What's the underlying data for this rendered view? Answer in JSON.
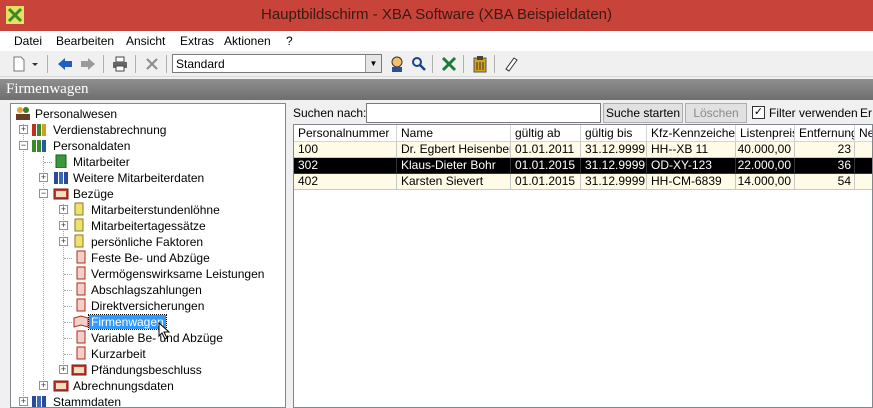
{
  "window": {
    "title": "Hauptbildschirm - XBA Software (XBA Beispieldaten)"
  },
  "menu": [
    "Datei",
    "Bearbeiten",
    "Ansicht",
    "Extras",
    "Aktionen",
    "?"
  ],
  "toolbar": {
    "view_combo_value": "Standard"
  },
  "panel": {
    "title": "Firmenwagen"
  },
  "tree": {
    "items": [
      {
        "label": "Personalwesen"
      },
      {
        "label": "Verdienstabrechnung"
      },
      {
        "label": "Personaldaten"
      },
      {
        "label": "Mitarbeiter"
      },
      {
        "label": "Weitere Mitarbeiterdaten"
      },
      {
        "label": "Bezüge"
      },
      {
        "label": "Mitarbeiterstundenlöhne"
      },
      {
        "label": "Mitarbeitertagessätze"
      },
      {
        "label": "persönliche Faktoren"
      },
      {
        "label": "Feste Be- und Abzüge"
      },
      {
        "label": "Vermögenswirksame Leistungen"
      },
      {
        "label": "Abschlagszahlungen"
      },
      {
        "label": "Direktversicherungen"
      },
      {
        "label": "Firmenwagen"
      },
      {
        "label": "Variable Be- und Abzüge"
      },
      {
        "label": "Kurzarbeit"
      },
      {
        "label": "Pfändungsbeschluss"
      },
      {
        "label": "Abrechnungsdaten"
      },
      {
        "label": "Stammdaten"
      }
    ]
  },
  "search": {
    "label": "Suchen nach:",
    "value": "",
    "start_button": "Suche starten",
    "clear_button": "Löschen",
    "filter_label": "Filter verwenden",
    "filter_checked": "✓",
    "extra_button": "Er"
  },
  "table": {
    "columns": [
      "Personalnummer",
      "Name",
      "gültig ab",
      "gültig bis",
      "Kfz-Kennzeichen",
      "Listenpreis",
      "Entfernung",
      "Ne"
    ],
    "rows": [
      {
        "cells": [
          "100",
          "Dr. Egbert Heisenberg",
          "01.01.2011",
          "31.12.9999",
          "HH--XB 11",
          "40.000,00",
          "23",
          ""
        ]
      },
      {
        "cells": [
          "302",
          "Klaus-Dieter Bohr",
          "01.01.2015",
          "31.12.9999",
          "OD-XY-123",
          "22.000,00",
          "36",
          ""
        ]
      },
      {
        "cells": [
          "402",
          "Karsten Sievert",
          "01.01.2015",
          "31.12.9999",
          "HH-CM-6839",
          "14.000,00",
          "54",
          ""
        ]
      }
    ]
  },
  "colors": {
    "titlebar": "#c8433a",
    "selection": "#3399ff",
    "row_selected": "#000000",
    "row_normal": "#fffbe6"
  }
}
